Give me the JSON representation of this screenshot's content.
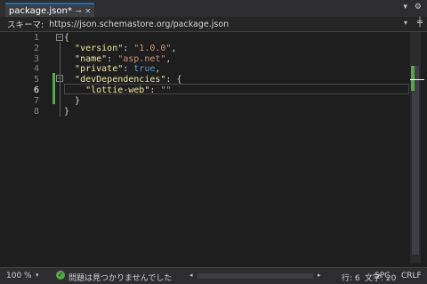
{
  "tab": {
    "title": "package.json*",
    "pin_icon": "pin-icon",
    "close_icon": "close-icon"
  },
  "toolbar": {
    "dropdown_icon": "chevron-down-icon",
    "settings_icon": "gear-icon"
  },
  "schema": {
    "label": "スキーマ:",
    "url": "https://json.schemastore.org/package.json"
  },
  "editor": {
    "line_numbers": [
      "1",
      "2",
      "3",
      "4",
      "5",
      "6",
      "7",
      "8"
    ],
    "current_line": 6,
    "lines": [
      [
        {
          "t": "{",
          "c": "p"
        }
      ],
      [
        {
          "t": "  ",
          "c": "p"
        },
        {
          "t": "\"version\"",
          "c": "k"
        },
        {
          "t": ": ",
          "c": "p"
        },
        {
          "t": "\"1.0.0\"",
          "c": "s"
        },
        {
          "t": ",",
          "c": "p"
        }
      ],
      [
        {
          "t": "  ",
          "c": "p"
        },
        {
          "t": "\"name\"",
          "c": "k"
        },
        {
          "t": ": ",
          "c": "p"
        },
        {
          "t": "\"asp.net\"",
          "c": "s"
        },
        {
          "t": ",",
          "c": "p"
        }
      ],
      [
        {
          "t": "  ",
          "c": "p"
        },
        {
          "t": "\"private\"",
          "c": "k"
        },
        {
          "t": ": ",
          "c": "p"
        },
        {
          "t": "true",
          "c": "b"
        },
        {
          "t": ",",
          "c": "p"
        }
      ],
      [
        {
          "t": "  ",
          "c": "p"
        },
        {
          "t": "\"devDependencies\"",
          "c": "k"
        },
        {
          "t": ": {",
          "c": "p"
        }
      ],
      [
        {
          "t": "    ",
          "c": "p"
        },
        {
          "t": "\"lottie-web\"",
          "c": "k"
        },
        {
          "t": ": ",
          "c": "p"
        },
        {
          "t": "\"\"",
          "c": "s"
        }
      ],
      [
        {
          "t": "  }",
          "c": "p"
        }
      ],
      [
        {
          "t": "}",
          "c": "p"
        }
      ]
    ]
  },
  "status": {
    "zoom": "100 %",
    "issues_icon": "check-circle-icon",
    "issues": "問題は見つかりませんでした",
    "line": "行: 6",
    "char": "文字: 20",
    "spc": "SPC",
    "crlf": "CRLF"
  }
}
